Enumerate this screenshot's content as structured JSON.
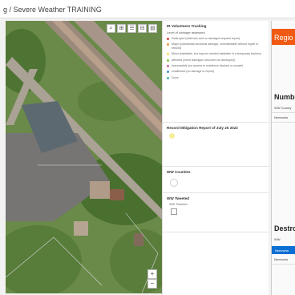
{
  "page": {
    "title": "g / Severe Weather TRAINING"
  },
  "map": {
    "tools": [
      "⌕",
      "⊞",
      "☰",
      "⊟",
      "▤"
    ],
    "zoom_in": "+",
    "zoom_out": "−"
  },
  "panel": {
    "tracking": {
      "title": "IR Volunteers Tracking",
      "subtitle": "Level of damage assessed",
      "legend": [
        {
          "label": "Destroyed (total loss and no damaged request report)",
          "color": "#e0483c"
        },
        {
          "label": "Major (substantial structural damage, uninhabitable without repair or rebuild)",
          "color": "#f09a3a"
        },
        {
          "label": "Minor (habitable, but may be needed habitable in a temporary fashion)",
          "color": "#f2df52"
        },
        {
          "label": "Affected (minor damages structure not destroyed)",
          "color": "#8cc540"
        },
        {
          "label": "Inaccessible (no access to residence blocked or unsafe)",
          "color": "#d860a9"
        },
        {
          "label": "Unaffected (no damage to report)",
          "color": "#4b8dd6"
        },
        {
          "label": "Done",
          "color": "#3fb6a8"
        }
      ]
    },
    "mitigation": {
      "title": "Record Mitigation Report of July 25 2022"
    },
    "ww_counties": {
      "title": "WW Counties"
    },
    "ww_tweeted": {
      "title": "WW Tweeted",
      "checkbox_label": "WW Tweeted"
    }
  },
  "right_panel": {
    "header": "Regio",
    "numbers_header": "Number",
    "numbers_rows": [
      "WW County",
      "Nenewha"
    ],
    "destroyed_header": "Destro",
    "destroyed_rows": [
      "WW",
      "Nenewha",
      "Nenewha"
    ]
  }
}
